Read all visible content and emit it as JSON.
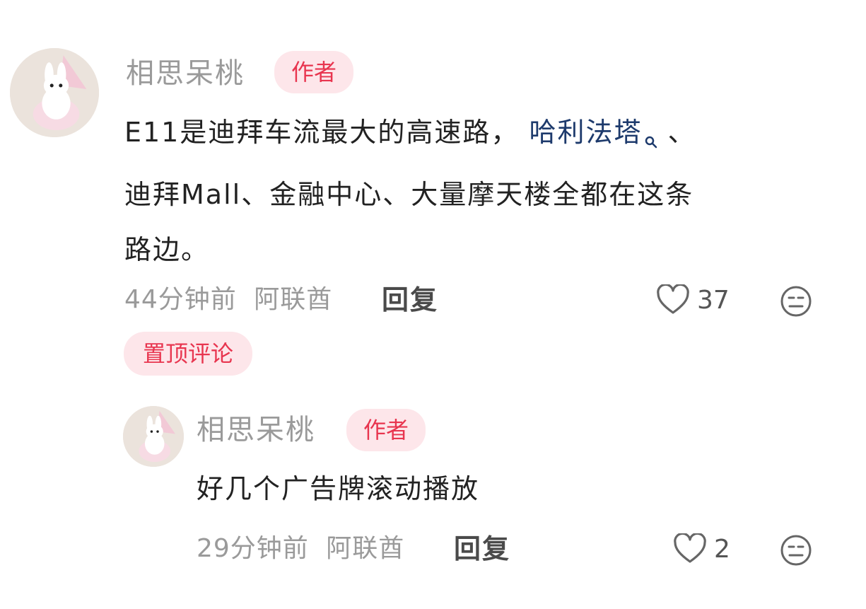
{
  "comments": [
    {
      "username": "相思呆桃",
      "badge": "作者",
      "text_lines": [
        "E11是迪拜车流最大的高速路，",
        "哈利法塔",
        "、",
        "迪拜Mall、金融中心、大量摩天楼全都在这条",
        "路边。"
      ],
      "time": "44分钟前",
      "location": "阿联酋",
      "reply_label": "回复",
      "likes": "37",
      "pinned_label": "置顶评论"
    },
    {
      "username": "相思呆桃",
      "badge": "作者",
      "text": "好几个广告牌滚动播放",
      "time": "29分钟前",
      "location": "阿联酋",
      "reply_label": "回复",
      "likes": "2"
    }
  ],
  "icons": {
    "avatar": "avatar-rabbit-image",
    "search": "search-mini-icon",
    "like": "heart-outline-icon",
    "more": "neutral-face-icon"
  },
  "colors": {
    "badge_bg": "#fde6ea",
    "badge_text": "#e8354f",
    "link": "#1d3a6c"
  }
}
